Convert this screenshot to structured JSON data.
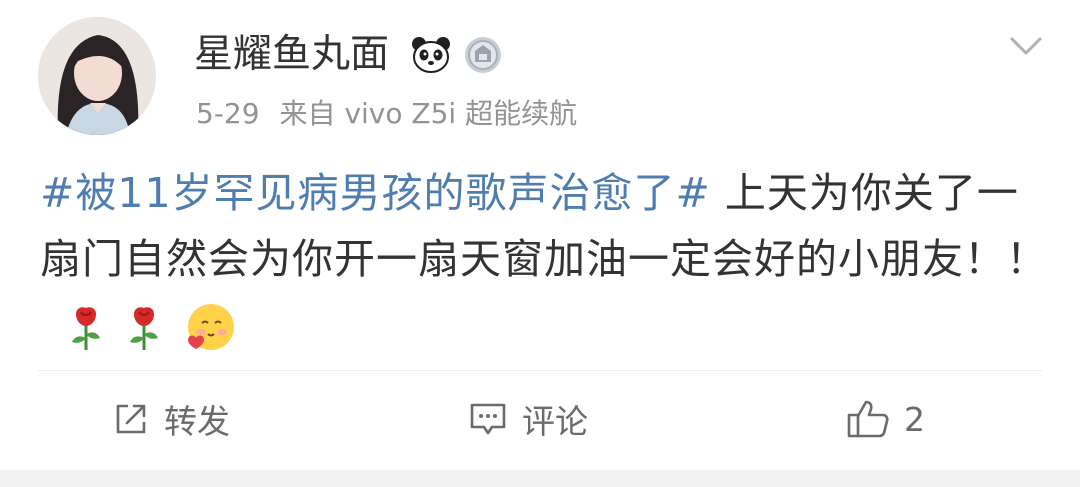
{
  "post": {
    "username": "星耀鱼丸面",
    "badges": [
      "panda-icon",
      "medal-icon"
    ],
    "date": "5-29",
    "source": "来自 vivo Z5i 超能续航",
    "topic": "#被11岁罕见病男孩的歌声治愈了#",
    "text": " 上天为你关了一扇门自然会为你开一扇天窗加油一定会好的小朋友！！",
    "emojis": [
      "rose-icon",
      "rose-icon",
      "love-face-icon"
    ]
  },
  "actions": {
    "repost_label": "转发",
    "comment_label": "评论",
    "like_count": "2"
  },
  "colors": {
    "topic": "#507daf",
    "text": "#333333",
    "meta": "#939393",
    "action": "#6b6b6b"
  }
}
